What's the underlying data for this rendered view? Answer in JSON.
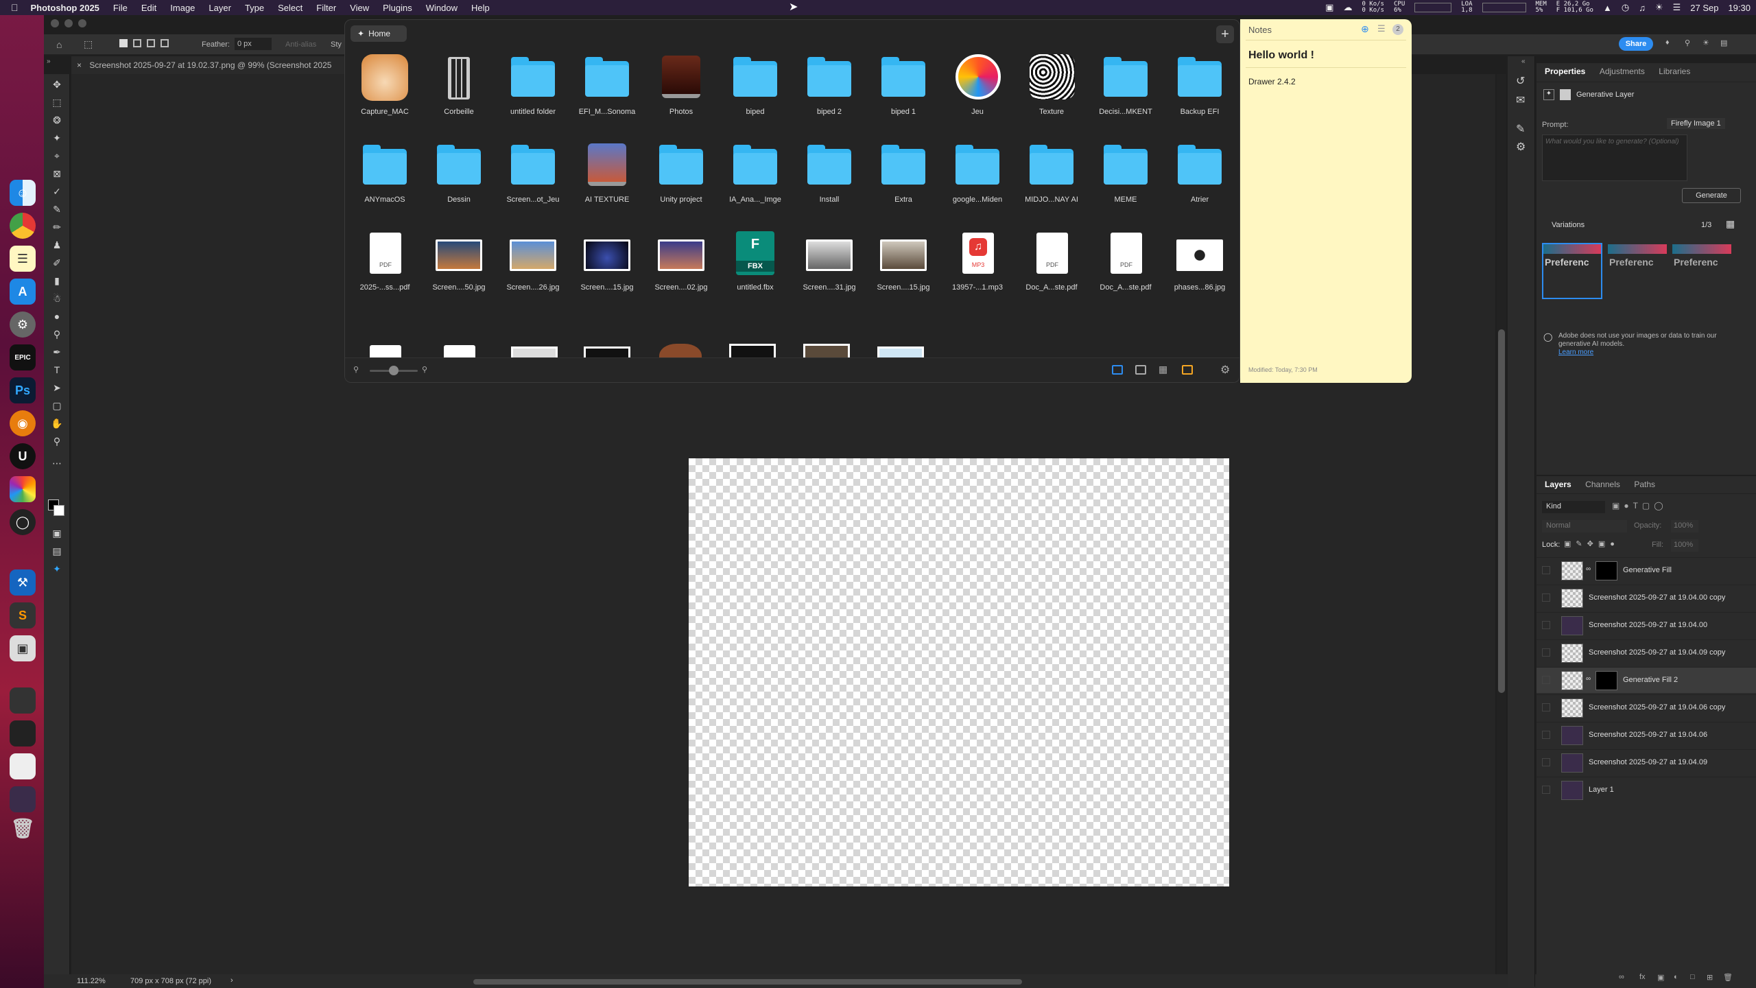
{
  "menubar": {
    "app": "Photoshop 2025",
    "items": [
      "File",
      "Edit",
      "Image",
      "Layer",
      "Type",
      "Select",
      "Filter",
      "View",
      "Plugins",
      "Window",
      "Help"
    ],
    "net_up": "0 Ko/s",
    "net_down": "0 Ko/s",
    "cpu_label": "CPU",
    "cpu_value": "6%",
    "load_label": "LOA",
    "load_value": "1,8",
    "mem_label": "MEM",
    "mem_value": "5%",
    "disk_e": "E 26,2 Go",
    "disk_f": "F 101,6 Go",
    "date": "27 Sep",
    "time": "19:30"
  },
  "ps": {
    "feather_label": "Feather:",
    "feather_value": "0 px",
    "antialias": "Anti-alias",
    "style_label": "Sty",
    "doc_tab": "Screenshot 2025-09-27 at 19.02.37.png @ 99% (Screenshot 2025",
    "share": "Share",
    "zoom": "111.22%",
    "doc_size": "709 px x 708 px (72 ppi)"
  },
  "finder": {
    "home": "Home",
    "plus": "+",
    "items": [
      {
        "label": "Capture_MAC",
        "kind": "app-fox"
      },
      {
        "label": "Corbeille",
        "kind": "trash"
      },
      {
        "label": "untitled folder",
        "kind": "folder"
      },
      {
        "label": "EFI_M...Sonoma",
        "kind": "folder"
      },
      {
        "label": "Photos",
        "kind": "drive"
      },
      {
        "label": "biped",
        "kind": "folder"
      },
      {
        "label": "biped 2",
        "kind": "folder"
      },
      {
        "label": "biped 1",
        "kind": "folder"
      },
      {
        "label": "Jeu",
        "kind": "app-swirl"
      },
      {
        "label": "Texture",
        "kind": "texture"
      },
      {
        "label": "Decisi...MKENT",
        "kind": "folder"
      },
      {
        "label": "Backup EFI",
        "kind": "folder"
      },
      {
        "label": "ANYmacOS",
        "kind": "folder"
      },
      {
        "label": "Dessin",
        "kind": "folder"
      },
      {
        "label": "Screen...ot_Jeu",
        "kind": "folder"
      },
      {
        "label": "AI TEXTURE",
        "kind": "drive-red"
      },
      {
        "label": "Unity project",
        "kind": "folder"
      },
      {
        "label": "IA_Ana..._Imge",
        "kind": "folder"
      },
      {
        "label": "Install",
        "kind": "folder"
      },
      {
        "label": "Extra",
        "kind": "folder"
      },
      {
        "label": "google...Miden",
        "kind": "folder"
      },
      {
        "label": "MIDJO...NAY AI",
        "kind": "folder"
      },
      {
        "label": "MEME",
        "kind": "folder"
      },
      {
        "label": "Atrier",
        "kind": "folder"
      },
      {
        "label": "2025-...ss...pdf",
        "kind": "pdf"
      },
      {
        "label": "Screen....50.jpg",
        "kind": "img-sky"
      },
      {
        "label": "Screen....26.jpg",
        "kind": "img-desert"
      },
      {
        "label": "Screen....15.jpg",
        "kind": "img-dark"
      },
      {
        "label": "Screen....02.jpg",
        "kind": "img-purple"
      },
      {
        "label": "untitled.fbx",
        "kind": "fbx"
      },
      {
        "label": "Screen....31.jpg",
        "kind": "img-grey"
      },
      {
        "label": "Screen....15.jpg",
        "kind": "img-stone"
      },
      {
        "label": "13957-...1.mp3",
        "kind": "mp3"
      },
      {
        "label": "Doc_A...ste.pdf",
        "kind": "pdf"
      },
      {
        "label": "Doc_A...ste.pdf",
        "kind": "pdf"
      },
      {
        "label": "phases...86.jpg",
        "kind": "img-phases"
      }
    ],
    "pdf_tag": "PDF",
    "mp3_tag": "MP3",
    "fbx_tag": "FBX"
  },
  "notes": {
    "header": "Notes",
    "count": "2",
    "title": "Hello world !",
    "line": "Drawer 2.4.2",
    "modified": "Modified: Today, 7:30 PM"
  },
  "properties": {
    "tabs": [
      "Properties",
      "Adjustments",
      "Libraries"
    ],
    "layer_type": "Generative Layer",
    "prompt_label": "Prompt:",
    "model": "Firefly Image 1",
    "prompt_placeholder": "What would you like to generate? (Optional)",
    "generate": "Generate",
    "variations": "Variations",
    "variation_count": "1/3",
    "variation_text": "Preferenc",
    "notice": "Adobe does not use your images or data to train our generative AI models.",
    "learn_more": "Learn more"
  },
  "layers": {
    "tabs": [
      "Layers",
      "Channels",
      "Paths"
    ],
    "kind": "Kind",
    "blend": "Normal",
    "opacity_label": "Opacity:",
    "opacity": "100%",
    "lock_label": "Lock:",
    "fill_label": "Fill:",
    "fill": "100%",
    "rows": [
      {
        "name": "Generative Fill",
        "mask": true,
        "dark": false
      },
      {
        "name": "Screenshot 2025-09-27 at 19.04.00 copy",
        "mask": false,
        "dark": false
      },
      {
        "name": "Screenshot 2025-09-27 at 19.04.00",
        "mask": false,
        "dark": true
      },
      {
        "name": "Screenshot 2025-09-27 at 19.04.09 copy",
        "mask": false,
        "dark": false
      },
      {
        "name": "Generative Fill 2",
        "mask": true,
        "dark": false,
        "selected": true
      },
      {
        "name": "Screenshot 2025-09-27 at 19.04.06 copy",
        "mask": false,
        "dark": false
      },
      {
        "name": "Screenshot 2025-09-27 at 19.04.06",
        "mask": false,
        "dark": true
      },
      {
        "name": "Screenshot 2025-09-27 at 19.04.09",
        "mask": false,
        "dark": true
      },
      {
        "name": "Layer 1",
        "mask": false,
        "dark": true
      }
    ]
  },
  "colors": {
    "accent": "#2d8cf0",
    "folder": "#35b6f2",
    "notes_bg": "#fff7c2"
  }
}
